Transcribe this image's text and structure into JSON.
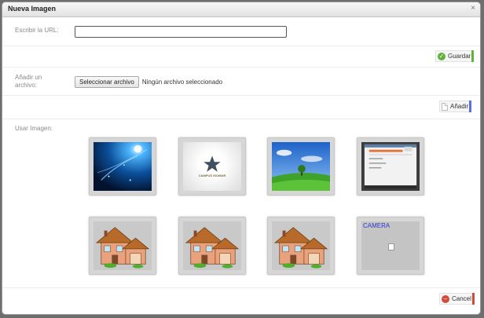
{
  "dialog": {
    "title": "Nueva Imagen",
    "close_symbol": "×"
  },
  "url_section": {
    "label": "Escribir la URL:",
    "value": "",
    "save_label": "Guardar",
    "save_icon": "check-circle-icon",
    "save_accent": "#5fb33b"
  },
  "file_section": {
    "label": "Añadir un archivo:",
    "choose_label": "Seleccionar archivo",
    "status": "Ningún archivo seleccionado",
    "add_label": "Añadir",
    "add_icon": "page-icon",
    "add_accent": "#5b6ee8"
  },
  "gallery": {
    "label": "Usar Imagen:",
    "items": [
      {
        "kind": "photo",
        "subject": "blue-space"
      },
      {
        "kind": "logo",
        "caption": "CAMPUS ISOMAR"
      },
      {
        "kind": "photo",
        "subject": "landscape"
      },
      {
        "kind": "screenshot",
        "subject": "page"
      },
      {
        "kind": "clipart",
        "subject": "house"
      },
      {
        "kind": "clipart",
        "subject": "house"
      },
      {
        "kind": "clipart",
        "subject": "house"
      },
      {
        "kind": "broken",
        "caption": "CAMERA"
      }
    ]
  },
  "footer": {
    "cancel_label": "Cancel",
    "cancel_icon": "cancel-circle-icon",
    "cancel_accent": "#d24a3a"
  }
}
